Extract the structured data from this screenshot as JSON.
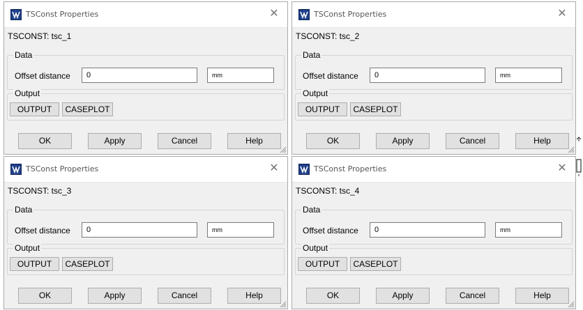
{
  "dialogs": [
    {
      "title": "TSConst Properties",
      "object_label": "TSCONST: tsc_1",
      "data_group": "Data",
      "offset_label": "Offset distance",
      "offset_value": "0",
      "unit_value": "mm",
      "output_group": "Output",
      "output_button": "OUTPUT",
      "caseplot_button": "CASEPLOT",
      "ok": "OK",
      "apply": "Apply",
      "cancel": "Cancel",
      "help": "Help",
      "close": "✕"
    },
    {
      "title": "TSConst Properties",
      "object_label": "TSCONST: tsc_2",
      "data_group": "Data",
      "offset_label": "Offset distance",
      "offset_value": "0",
      "unit_value": "mm",
      "output_group": "Output",
      "output_button": "OUTPUT",
      "caseplot_button": "CASEPLOT",
      "ok": "OK",
      "apply": "Apply",
      "cancel": "Cancel",
      "help": "Help",
      "close": "✕"
    },
    {
      "title": "TSConst Properties",
      "object_label": "TSCONST: tsc_3",
      "data_group": "Data",
      "offset_label": "Offset distance",
      "offset_value": "0",
      "unit_value": "mm",
      "output_group": "Output",
      "output_button": "OUTPUT",
      "caseplot_button": "CASEPLOT",
      "ok": "OK",
      "apply": "Apply",
      "cancel": "Cancel",
      "help": "Help",
      "close": "✕"
    },
    {
      "title": "TSConst Properties",
      "object_label": "TSCONST: tsc_4",
      "data_group": "Data",
      "offset_label": "Offset distance",
      "offset_value": "0",
      "unit_value": "mm",
      "output_group": "Output",
      "output_button": "OUTPUT",
      "caseplot_button": "CASEPLOT",
      "ok": "OK",
      "apply": "Apply",
      "cancel": "Cancel",
      "help": "Help",
      "close": "✕"
    }
  ],
  "icons": {
    "app": "app-logo-icon",
    "close": "close-icon",
    "resize": "resize-grip-icon"
  }
}
